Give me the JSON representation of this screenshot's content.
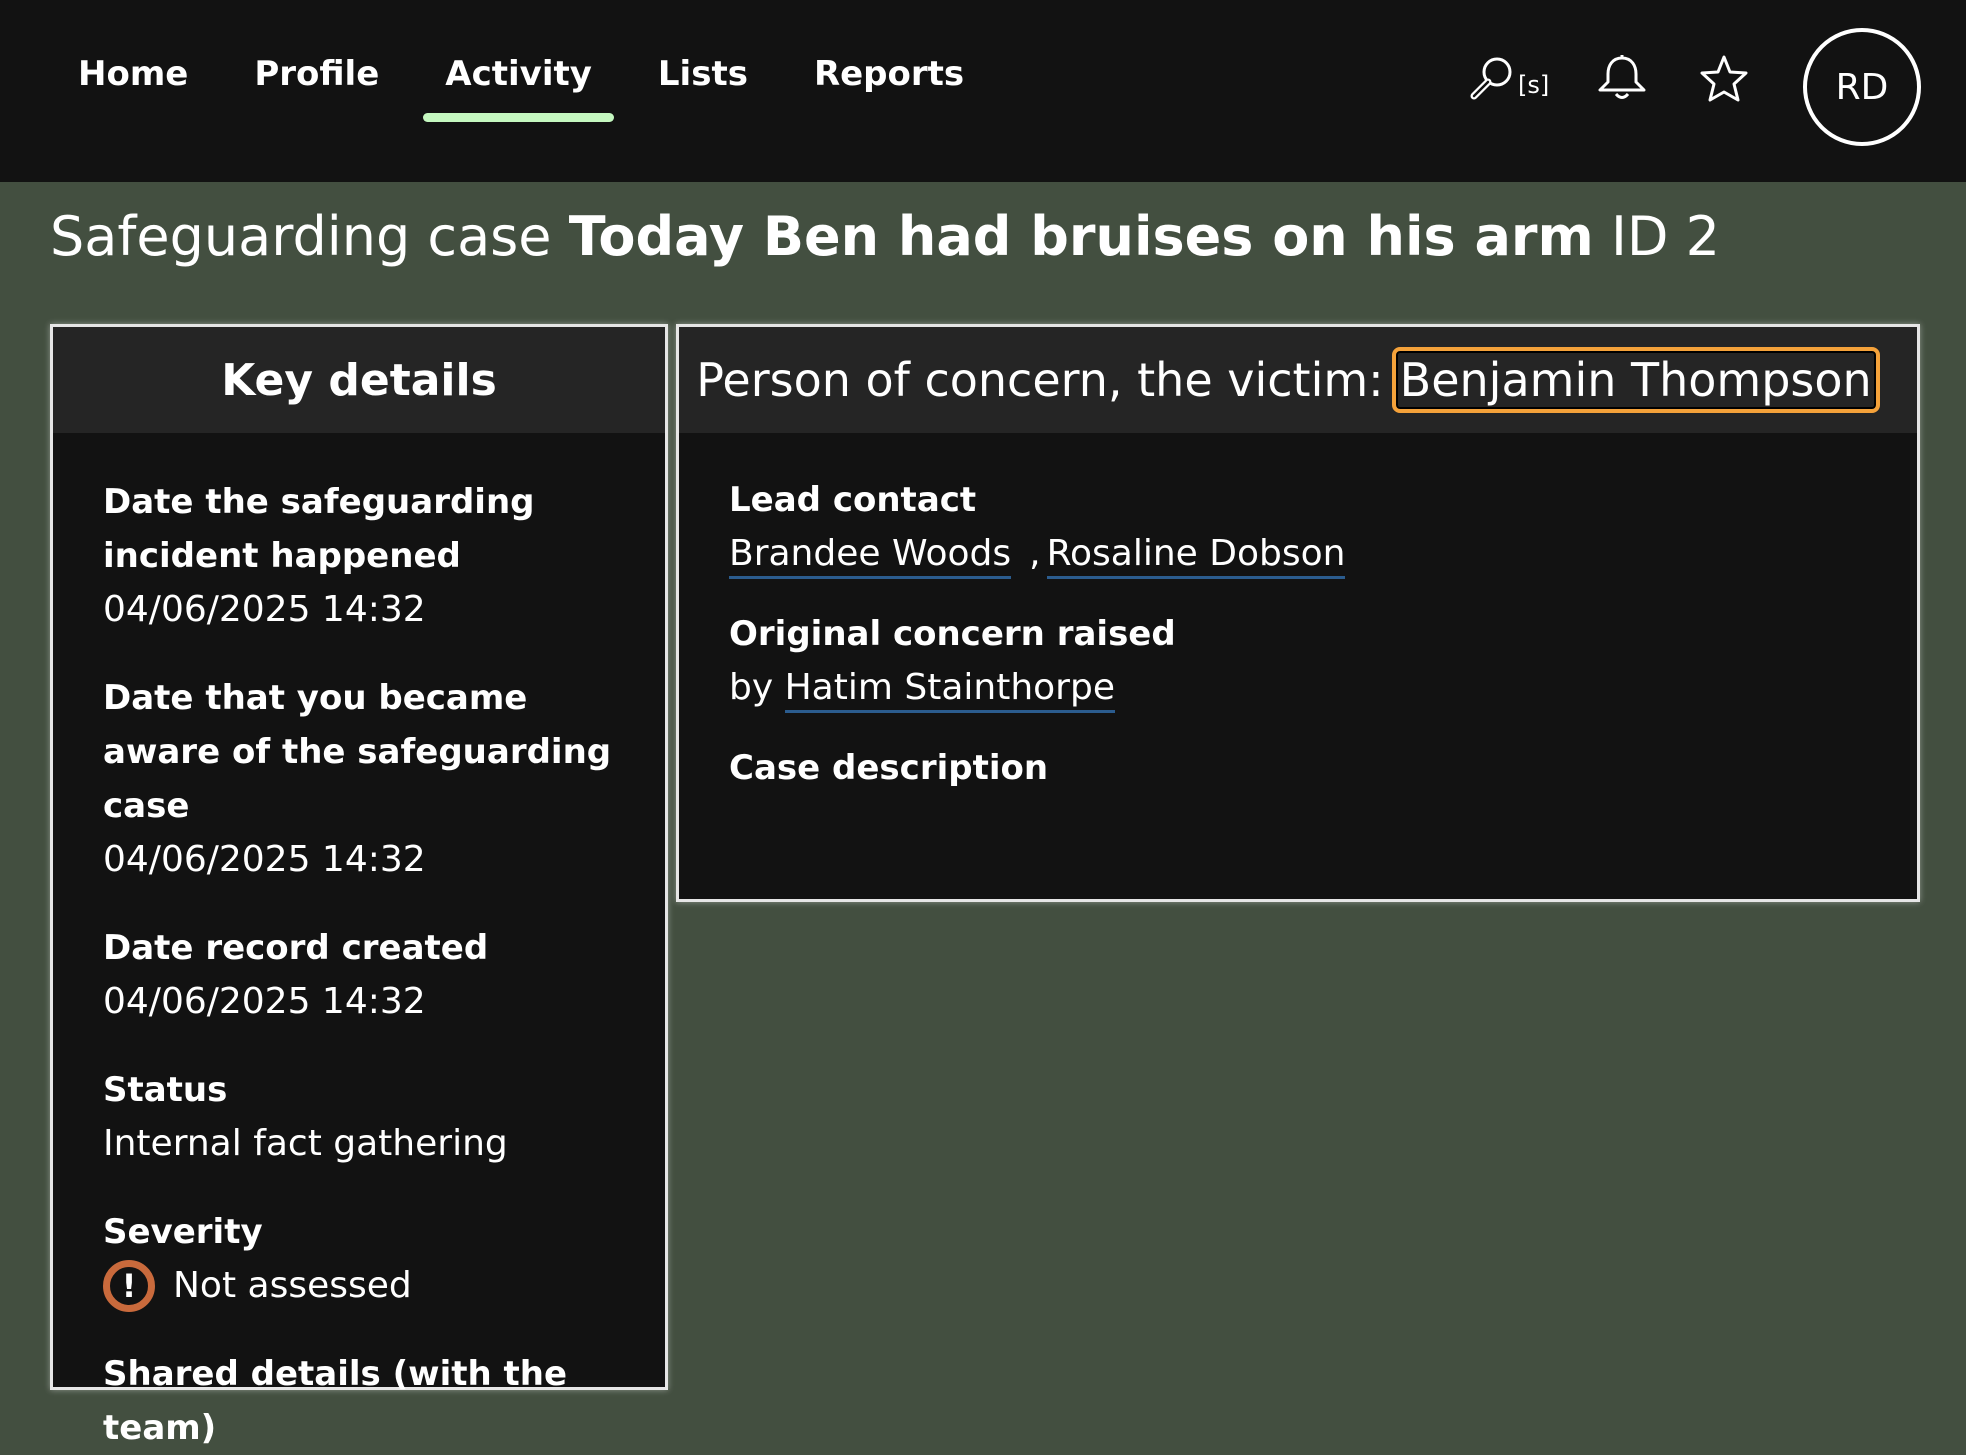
{
  "nav": {
    "items": [
      {
        "label": "Home"
      },
      {
        "label": "Profile"
      },
      {
        "label": "Activity"
      },
      {
        "label": "Lists"
      },
      {
        "label": "Reports"
      }
    ],
    "active": "Activity",
    "search_hint": "[s]",
    "avatar_initials": "RD"
  },
  "page": {
    "title_prefix": "Safeguarding case",
    "case_name": "Today Ben had bruises on his arm",
    "id_label": "ID 2"
  },
  "key_details": {
    "heading": "Key details",
    "incident_date": {
      "label": "Date the safeguarding incident happened",
      "value": "04/06/2025 14:32"
    },
    "aware_date": {
      "label": "Date that you became aware of the safeguarding case",
      "value": "04/06/2025 14:32"
    },
    "record_created": {
      "label": "Date record created",
      "value": "04/06/2025 14:32"
    },
    "status": {
      "label": "Status",
      "value": "Internal fact gathering"
    },
    "severity": {
      "label": "Severity",
      "icon_text": "!",
      "value": "Not assessed",
      "icon_color": "#c96a3c"
    },
    "shared_details": {
      "label": "Shared details (with the team)"
    }
  },
  "person_panel": {
    "heading_prefix": "Person of concern, the victim:",
    "person_name": "Benjamin Thompson",
    "lead_contact": {
      "label": "Lead contact",
      "contacts": [
        "Brandee Woods",
        "Rosaline Dobson"
      ],
      "separator": ","
    },
    "original_concern": {
      "label": "Original concern raised",
      "by_prefix": "by",
      "by_name": "Hatim Stainthorpe"
    },
    "case_description": {
      "label": "Case description"
    }
  },
  "colors": {
    "page_bg": "#434f40",
    "topbar_bg": "#121212",
    "active_tab_indicator": "#c5f8c0",
    "focus_outline": "#f5a23a",
    "link_underline": "#2b5c8e"
  }
}
